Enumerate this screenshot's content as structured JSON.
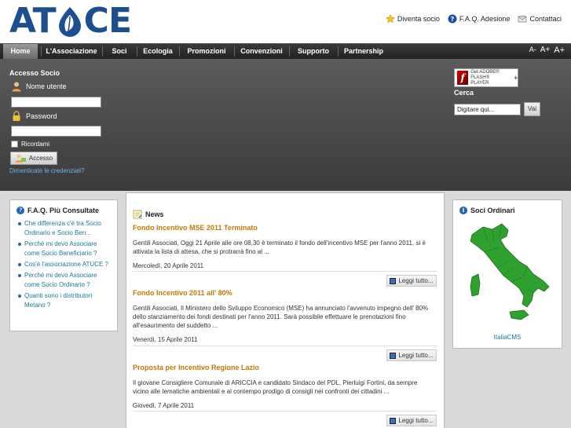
{
  "header": {
    "logo_left": "AT",
    "logo_right": "CE",
    "links": [
      {
        "label": "Diventa socio",
        "icon": "star-icon"
      },
      {
        "label": "F.A.Q. Adesione",
        "icon": "help-icon"
      },
      {
        "label": "Contattaci",
        "icon": "mail-icon"
      }
    ]
  },
  "nav": {
    "items": [
      "Home",
      "L'Associazione",
      "Soci",
      "Ecologia",
      "Promozioni",
      "Convenzioni",
      "Supporto",
      "Partnership"
    ],
    "active": "Home",
    "font_sizes": [
      "A-",
      "A+",
      "A+"
    ]
  },
  "login": {
    "title": "Accesso Socio",
    "username_label": "Nome utente",
    "password_label": "Password",
    "remember_label": "Ricordami",
    "button_label": "Accesso",
    "forgot_link": "Dimenticate le credenziali?"
  },
  "flash": {
    "line1": "Get ADOBE®",
    "line2": "FLASH® PLAYER"
  },
  "search": {
    "title": "Cerca",
    "value": "Digitare qui...",
    "button": "Vai"
  },
  "faq": {
    "title": "F.A.Q. Più Consultate",
    "items": [
      "Che differenza c'è tra Socio Ordinario e Socio Ben...",
      "Perchè mi devo Associare come Socio Beneficiario ?",
      "Cos'è l'associazione ATUCE ?",
      "Perchè mi devo Associare come Socio Ordinario ?",
      "Quanti sono i distributori Metano ?"
    ]
  },
  "news": {
    "title": "News",
    "read_more": "Leggi tutto...",
    "items": [
      {
        "title": "Fondo Incentivo MSE 2011 Terminato",
        "text": "Gentili Associati, Oggi 21 Aprile alle ore 08,30 è terminato il fondo dell'incentivo MSE per l'anno 2011, si è attivata la lista di attesa, che si protrarrà fino al ...",
        "date": "Mercoledì, 20 Aprile 2011"
      },
      {
        "title": "Fondo Incentivo 2011 all' 80%",
        "text": "Gentili Associati,   Il Ministero dello Sviluppo Economico (MSE) ha annunciato l'avvenuto impegno dell' 80% dello stanziamento dei fondi destinati per l'anno 2011. Sarà possibile effettuare le prenotazioni fino all'esaurimento del suddetto ...",
        "date": "Venerdì, 15 Aprile 2011"
      },
      {
        "title": "Proposta per Incentivo Regione Lazio",
        "text": "Il giovane Consigliere Comunale di ARICCIA e candidato Sindaco del PDL, Pierluigi Fortini, da sempre vicino alle tematiche ambientali e al contempo prodigo di consigli nei confronti dei cittadini ...",
        "date": "Giovedì, 7 Aprile 2011"
      }
    ]
  },
  "soci": {
    "title": "Soci Ordinari",
    "caption": "ItaliaCMS",
    "map_color": "#2ea12e"
  }
}
